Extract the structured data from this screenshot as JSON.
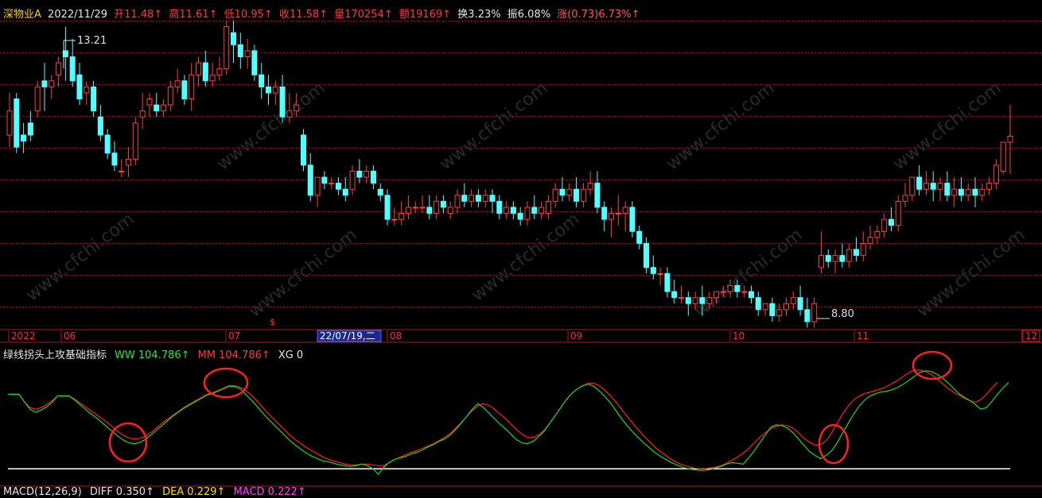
{
  "header": {
    "stock_name": "深物业A",
    "date": "2022/11/29",
    "open_label": "开",
    "open": "11.48↑",
    "high_label": "高",
    "high": "11.61↑",
    "low_label": "低",
    "low": "10.95↑",
    "close_label": "收",
    "close": "11.58↑",
    "volume_label": "量",
    "volume": "170254↑",
    "amount_label": "额",
    "amount": "19169↑",
    "turnover_label": "换",
    "turnover": "3.23%",
    "amplitude_label": "振",
    "amplitude": "6.08%",
    "change_label": "涨",
    "change": "(0.73)6.73%↑"
  },
  "time_axis": {
    "labels": [
      "2022",
      "06",
      "07",
      "08",
      "09",
      "10",
      "11",
      "12"
    ],
    "cursor_date": "22/07/19,二"
  },
  "price_annotations": {
    "high_mark": "13.21",
    "low_mark": "8.80",
    "event_marker": "$"
  },
  "indicator": {
    "name": "绿线拐头上攻基础指标",
    "ww_label": "WW",
    "ww_value": "104.786↑",
    "mm_label": "MM",
    "mm_value": "104.786↑",
    "xg_label": "XG",
    "xg_value": "0"
  },
  "macd_row": {
    "name": "MACD(12,26,9)",
    "diff": "DIFF 0.350↑",
    "dea": "DEA 0.229↑",
    "macd": "MACD 0.222↑"
  },
  "watermark": "www.cfchi.com",
  "colors": {
    "up": "#ff4040",
    "down": "#54ffff",
    "grid": "#8b1a1a",
    "ww": "#1ed61e",
    "mm": "#ff2020",
    "base": "#ffffff",
    "circle": "#ff2020"
  },
  "chart_data": {
    "type": "candlestick",
    "price_range": [
      8.5,
      13.5
    ],
    "candles": [
      [
        11.6,
        12.3,
        12.0,
        11.4
      ],
      [
        12.2,
        12.3,
        11.4,
        11.3
      ],
      [
        11.6,
        11.8,
        11.5,
        11.3
      ],
      [
        11.8,
        12.0,
        11.6,
        11.5
      ],
      [
        12.0,
        12.5,
        12.4,
        11.9
      ],
      [
        12.5,
        12.8,
        12.4,
        12.0
      ],
      [
        12.4,
        12.6,
        12.5,
        12.2
      ],
      [
        12.6,
        12.9,
        12.8,
        12.4
      ],
      [
        13.0,
        13.4,
        12.9,
        12.5
      ],
      [
        12.9,
        13.2,
        12.5,
        12.4
      ],
      [
        12.6,
        12.8,
        12.2,
        12.1
      ],
      [
        12.3,
        12.5,
        12.4,
        12.1
      ],
      [
        12.4,
        12.5,
        12.0,
        11.9
      ],
      [
        11.9,
        12.1,
        11.6,
        11.5
      ],
      [
        11.6,
        11.7,
        11.3,
        11.2
      ],
      [
        11.3,
        11.5,
        11.1,
        11.0
      ],
      [
        11.0,
        11.2,
        11.0,
        10.9
      ],
      [
        11.1,
        11.4,
        11.2,
        10.9
      ],
      [
        11.2,
        11.9,
        11.8,
        11.1
      ],
      [
        11.9,
        12.3,
        12.0,
        11.7
      ],
      [
        12.1,
        12.3,
        12.2,
        11.9
      ],
      [
        12.1,
        12.3,
        12.0,
        11.9
      ],
      [
        12.0,
        12.2,
        12.1,
        11.9
      ],
      [
        12.1,
        12.5,
        12.4,
        12.0
      ],
      [
        12.4,
        12.7,
        12.5,
        12.3
      ],
      [
        12.5,
        12.6,
        12.2,
        12.1
      ],
      [
        12.2,
        12.8,
        12.6,
        12.0
      ],
      [
        12.6,
        12.9,
        12.8,
        12.4
      ],
      [
        12.8,
        13.0,
        12.5,
        12.4
      ],
      [
        12.5,
        12.8,
        12.6,
        12.4
      ],
      [
        12.6,
        12.9,
        12.7,
        12.5
      ],
      [
        12.7,
        13.5,
        13.4,
        12.6
      ],
      [
        13.3,
        13.5,
        13.1,
        12.8
      ],
      [
        13.1,
        13.3,
        12.9,
        12.7
      ],
      [
        12.9,
        13.2,
        13.0,
        12.7
      ],
      [
        13.0,
        13.1,
        12.6,
        12.5
      ],
      [
        12.6,
        12.8,
        12.4,
        12.2
      ],
      [
        12.4,
        12.6,
        12.3,
        12.1
      ],
      [
        12.3,
        12.5,
        12.4,
        12.1
      ],
      [
        12.4,
        12.6,
        11.9,
        11.8
      ],
      [
        11.9,
        12.3,
        12.0,
        11.8
      ],
      [
        12.0,
        12.3,
        12.1,
        11.9
      ],
      [
        11.6,
        11.7,
        11.1,
        11.0
      ],
      [
        11.1,
        11.3,
        10.6,
        10.5
      ],
      [
        10.6,
        10.8,
        10.9,
        10.4
      ],
      [
        10.9,
        11.0,
        10.8,
        10.7
      ],
      [
        10.8,
        10.9,
        10.8,
        10.7
      ],
      [
        10.8,
        10.9,
        10.7,
        10.6
      ],
      [
        10.7,
        10.9,
        10.6,
        10.5
      ],
      [
        10.7,
        11.1,
        11.0,
        10.6
      ],
      [
        11.0,
        11.2,
        10.9,
        10.8
      ],
      [
        10.9,
        11.1,
        11.0,
        10.8
      ],
      [
        11.0,
        11.1,
        10.8,
        10.7
      ],
      [
        10.7,
        10.8,
        10.6,
        10.5
      ],
      [
        10.6,
        10.7,
        10.2,
        10.1
      ],
      [
        10.2,
        10.4,
        10.2,
        10.1
      ],
      [
        10.2,
        10.5,
        10.3,
        10.1
      ],
      [
        10.3,
        10.6,
        10.4,
        10.2
      ],
      [
        10.4,
        10.5,
        10.4,
        10.3
      ],
      [
        10.4,
        10.6,
        10.4,
        10.3
      ],
      [
        10.4,
        10.6,
        10.3,
        10.2
      ],
      [
        10.3,
        10.6,
        10.5,
        10.2
      ],
      [
        10.5,
        10.6,
        10.4,
        10.3
      ],
      [
        10.3,
        10.5,
        10.4,
        10.2
      ],
      [
        10.4,
        10.7,
        10.6,
        10.3
      ],
      [
        10.6,
        10.8,
        10.5,
        10.4
      ],
      [
        10.5,
        10.7,
        10.6,
        10.4
      ],
      [
        10.6,
        10.7,
        10.5,
        10.4
      ],
      [
        10.5,
        10.7,
        10.6,
        10.4
      ],
      [
        10.6,
        10.7,
        10.5,
        10.3
      ],
      [
        10.5,
        10.6,
        10.3,
        10.2
      ],
      [
        10.3,
        10.5,
        10.4,
        10.2
      ],
      [
        10.4,
        10.5,
        10.3,
        10.2
      ],
      [
        10.3,
        10.4,
        10.2,
        10.1
      ],
      [
        10.2,
        10.5,
        10.4,
        10.1
      ],
      [
        10.4,
        10.6,
        10.3,
        10.2
      ],
      [
        10.3,
        10.5,
        10.4,
        10.2
      ],
      [
        10.3,
        10.6,
        10.5,
        10.2
      ],
      [
        10.5,
        10.8,
        10.7,
        10.4
      ],
      [
        10.7,
        10.9,
        10.6,
        10.5
      ],
      [
        10.6,
        10.8,
        10.7,
        10.5
      ],
      [
        10.7,
        10.9,
        10.5,
        10.4
      ],
      [
        10.5,
        10.8,
        10.7,
        10.4
      ],
      [
        10.7,
        11.0,
        10.8,
        10.6
      ],
      [
        10.8,
        11.0,
        10.4,
        10.3
      ],
      [
        10.4,
        10.5,
        10.2,
        10.0
      ],
      [
        10.2,
        10.4,
        10.3,
        9.9
      ],
      [
        10.3,
        10.6,
        10.3,
        10.1
      ],
      [
        10.3,
        10.5,
        10.4,
        10.0
      ],
      [
        10.4,
        10.5,
        10.0,
        9.9
      ],
      [
        10.0,
        10.1,
        9.8,
        9.7
      ],
      [
        9.8,
        9.9,
        9.4,
        9.3
      ],
      [
        9.4,
        9.6,
        9.3,
        9.2
      ],
      [
        9.3,
        9.4,
        9.3,
        9.1
      ],
      [
        9.3,
        9.4,
        9.0,
        8.9
      ],
      [
        9.0,
        9.2,
        8.9,
        8.8
      ],
      [
        8.9,
        9.1,
        8.9,
        8.8
      ],
      [
        8.9,
        9.0,
        8.8,
        8.6
      ],
      [
        8.8,
        9.0,
        8.9,
        8.7
      ],
      [
        8.9,
        9.1,
        8.8,
        8.6
      ],
      [
        8.8,
        9.0,
        8.9,
        8.7
      ],
      [
        8.9,
        9.0,
        9.0,
        8.8
      ],
      [
        9.0,
        9.1,
        9.0,
        8.9
      ],
      [
        9.0,
        9.2,
        9.1,
        8.9
      ],
      [
        9.1,
        9.2,
        9.0,
        8.9
      ],
      [
        9.0,
        9.1,
        9.0,
        8.9
      ],
      [
        9.0,
        9.1,
        8.9,
        8.8
      ],
      [
        8.9,
        9.0,
        8.7,
        8.6
      ],
      [
        8.7,
        8.8,
        8.8,
        8.6
      ],
      [
        8.8,
        8.9,
        8.6,
        8.5
      ],
      [
        8.6,
        8.8,
        8.7,
        8.5
      ],
      [
        8.7,
        8.9,
        8.8,
        8.6
      ],
      [
        8.8,
        9.0,
        8.9,
        8.7
      ],
      [
        8.9,
        9.1,
        8.7,
        8.6
      ],
      [
        8.7,
        8.9,
        8.5,
        8.4
      ],
      [
        8.5,
        8.9,
        8.8,
        8.4
      ],
      [
        9.4,
        10.0,
        9.6,
        9.3
      ],
      [
        9.6,
        9.7,
        9.5,
        9.4
      ],
      [
        9.5,
        9.7,
        9.6,
        9.3
      ],
      [
        9.6,
        9.8,
        9.5,
        9.4
      ],
      [
        9.5,
        9.8,
        9.7,
        9.4
      ],
      [
        9.7,
        9.9,
        9.6,
        9.5
      ],
      [
        9.6,
        10.0,
        9.8,
        9.5
      ],
      [
        9.8,
        10.1,
        9.9,
        9.7
      ],
      [
        9.9,
        10.1,
        10.0,
        9.8
      ],
      [
        10.0,
        10.3,
        10.2,
        9.9
      ],
      [
        10.2,
        10.4,
        10.1,
        10.0
      ],
      [
        10.1,
        10.6,
        10.5,
        10.0
      ],
      [
        10.5,
        10.8,
        10.6,
        10.4
      ],
      [
        10.6,
        10.9,
        10.9,
        10.5
      ],
      [
        10.9,
        11.1,
        10.7,
        10.6
      ],
      [
        10.7,
        11.0,
        10.8,
        10.6
      ],
      [
        10.8,
        11.0,
        10.7,
        10.5
      ],
      [
        10.7,
        10.9,
        10.8,
        10.5
      ],
      [
        10.8,
        11.0,
        10.6,
        10.5
      ],
      [
        10.6,
        10.9,
        10.7,
        10.4
      ],
      [
        10.7,
        10.9,
        10.6,
        10.5
      ],
      [
        10.6,
        10.8,
        10.7,
        10.5
      ],
      [
        10.7,
        10.9,
        10.6,
        10.4
      ],
      [
        10.6,
        10.8,
        10.7,
        10.5
      ],
      [
        10.7,
        10.9,
        10.8,
        10.6
      ],
      [
        10.8,
        11.2,
        11.1,
        10.7
      ],
      [
        11.0,
        11.3,
        11.48,
        10.95
      ],
      [
        11.48,
        12.1,
        11.58,
        10.95
      ]
    ],
    "ww_series": [
      9.5,
      9.5,
      9.5,
      8.5,
      7.6,
      7.2,
      7.5,
      7.9,
      8.5,
      9.3,
      9.3,
      9.3,
      8.8,
      8.2,
      7.6,
      7.0,
      6.5,
      5.9,
      5.3,
      4.7,
      4.1,
      3.6,
      3.3,
      3.2,
      3.4,
      3.8,
      4.4,
      5.0,
      5.6,
      6.2,
      6.8,
      7.3,
      7.8,
      8.2,
      8.6,
      9.0,
      9.4,
      9.6,
      9.9,
      10.2,
      10.5,
      10.5,
      10.2,
      9.5,
      8.8,
      8.0,
      7.2,
      6.4,
      5.7,
      5.0,
      4.3,
      3.6,
      3.0,
      2.5,
      2.0,
      1.6,
      1.3,
      1.0,
      0.9,
      0.7,
      0.5,
      0.4,
      0.3,
      0.4,
      0.6,
      0.4,
      0.0,
      -0.7,
      0.2,
      0.8,
      1.2,
      1.4,
      1.6,
      1.9,
      2.1,
      2.4,
      2.8,
      3.1,
      3.5,
      3.8,
      4.3,
      5.0,
      5.8,
      6.7,
      7.6,
      8.3,
      7.8,
      7.1,
      6.4,
      5.7,
      5.1,
      4.4,
      3.7,
      3.3,
      3.2,
      3.5,
      4.1,
      4.8,
      5.8,
      6.8,
      7.8,
      8.8,
      9.6,
      10.2,
      10.6,
      10.8,
      10.5,
      9.9,
      9.2,
      8.4,
      7.4,
      6.4,
      5.5,
      4.7,
      4.0,
      3.3,
      2.7,
      2.1,
      1.6,
      1.2,
      0.8,
      0.5,
      0.2,
      0.0,
      -0.1,
      -0.2,
      -0.2,
      -0.1,
      0.1,
      0.3,
      0.6,
      0.8,
      0.7,
      0.6,
      1.4,
      2.3,
      3.3,
      4.3,
      5.3,
      5.6,
      5.5,
      5.2,
      4.6,
      3.8,
      3.0,
      2.2,
      1.7,
      1.3,
      1.7,
      2.3,
      3.3,
      4.6,
      5.8,
      7.0,
      8.0,
      8.8,
      9.3,
      9.6,
      9.8,
      9.9,
      10.1,
      10.4,
      10.8,
      11.3,
      11.8,
      12.3,
      12.5,
      12.4,
      12.1,
      11.6,
      11.0,
      10.3,
      9.6,
      9.1,
      8.7,
      8.2,
      7.6,
      7.8,
      8.6,
      9.5,
      10.3,
      11.0
    ],
    "mm_series": [
      9.5,
      9.5,
      9.5,
      8.5,
      7.8,
      7.6,
      7.8,
      8.2,
      8.7,
      9.3,
      9.3,
      9.3,
      8.9,
      8.4,
      7.9,
      7.4,
      6.9,
      6.4,
      5.9,
      5.3,
      4.7,
      4.2,
      3.9,
      3.8,
      3.9,
      4.2,
      4.7,
      5.3,
      5.9,
      6.4,
      6.9,
      7.4,
      7.9,
      8.3,
      8.7,
      9.1,
      9.5,
      9.7,
      10.0,
      10.3,
      10.6,
      10.6,
      10.4,
      10.0,
      9.4,
      8.7,
      7.9,
      7.1,
      6.4,
      5.7,
      5.0,
      4.3,
      3.7,
      3.2,
      2.7,
      2.3,
      1.9,
      1.5,
      1.2,
      1.0,
      0.8,
      0.6,
      0.5,
      0.5,
      0.6,
      0.6,
      0.5,
      0.4,
      0.4,
      0.8,
      1.2,
      1.5,
      1.8,
      2.1,
      2.3,
      2.6,
      2.9,
      3.2,
      3.6,
      4.0,
      4.5,
      5.2,
      5.9,
      6.7,
      7.4,
      8.0,
      8.3,
      8.1,
      7.6,
      7.0,
      6.4,
      5.7,
      5.0,
      4.4,
      4.0,
      4.0,
      4.3,
      4.9,
      5.8,
      6.8,
      7.8,
      8.8,
      9.6,
      10.2,
      10.6,
      10.9,
      10.9,
      10.6,
      10.0,
      9.3,
      8.5,
      7.6,
      6.7,
      5.8,
      5.0,
      4.2,
      3.5,
      2.8,
      2.2,
      1.7,
      1.2,
      0.8,
      0.5,
      0.3,
      0.1,
      0.0,
      0.0,
      0.1,
      0.2,
      0.4,
      0.7,
      1.1,
      1.5,
      2.0,
      2.6,
      3.3,
      4.0,
      4.6,
      5.1,
      5.4,
      5.6,
      5.5,
      5.2,
      4.6,
      3.9,
      3.4,
      3.0,
      3.1,
      3.6,
      4.6,
      5.8,
      7.0,
      8.0,
      8.8,
      9.3,
      9.6,
      9.8,
      10.0,
      10.2,
      10.5,
      10.9,
      11.3,
      11.8,
      12.3,
      12.6,
      12.6,
      12.4,
      12.0,
      11.5,
      10.9,
      10.3,
      9.8,
      9.4,
      9.0,
      8.7,
      8.5,
      8.8,
      9.5,
      10.3,
      11.0
    ],
    "indicator_range": [
      -1.5,
      14
    ]
  }
}
